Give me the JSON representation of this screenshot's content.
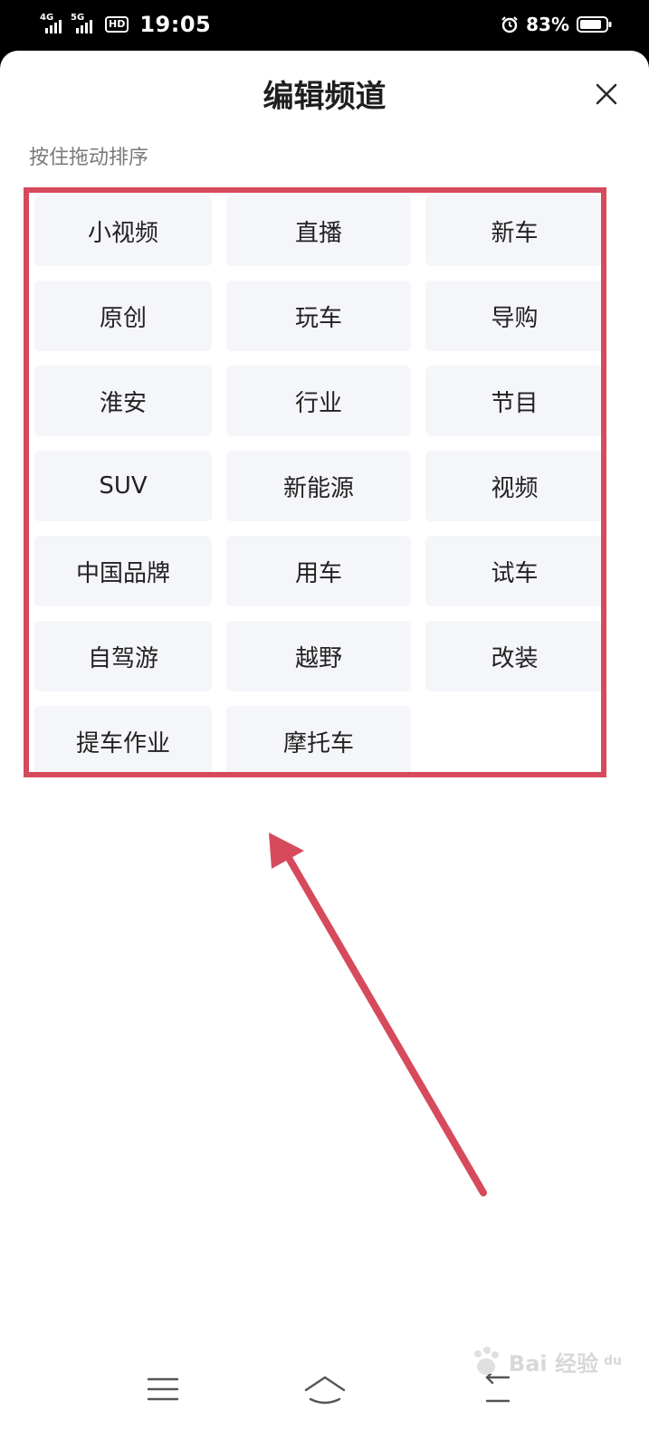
{
  "status_bar": {
    "net1": "4G",
    "net2": "5G",
    "hd": "HD",
    "time": "19:05",
    "battery": "83%"
  },
  "sheet": {
    "title": "编辑频道",
    "hint": "按住拖动排序"
  },
  "channels": [
    "小视频",
    "直播",
    "新车",
    "原创",
    "玩车",
    "导购",
    "淮安",
    "行业",
    "节目",
    "SUV",
    "新能源",
    "视频",
    "中国品牌",
    "用车",
    "试车",
    "自驾游",
    "越野",
    "改装",
    "提车作业",
    "摩托车"
  ],
  "icons": {
    "close": "close-icon",
    "alarm": "alarm-icon",
    "battery": "battery-icon",
    "menu": "menu-icon",
    "home": "home-icon",
    "back": "back-icon"
  },
  "colors": {
    "annotation": "#d64a5c",
    "chip_bg": "#f5f6fa",
    "status_bar_bg": "#000000"
  },
  "watermark": {
    "text": "Bai 经验",
    "sub": "du"
  }
}
